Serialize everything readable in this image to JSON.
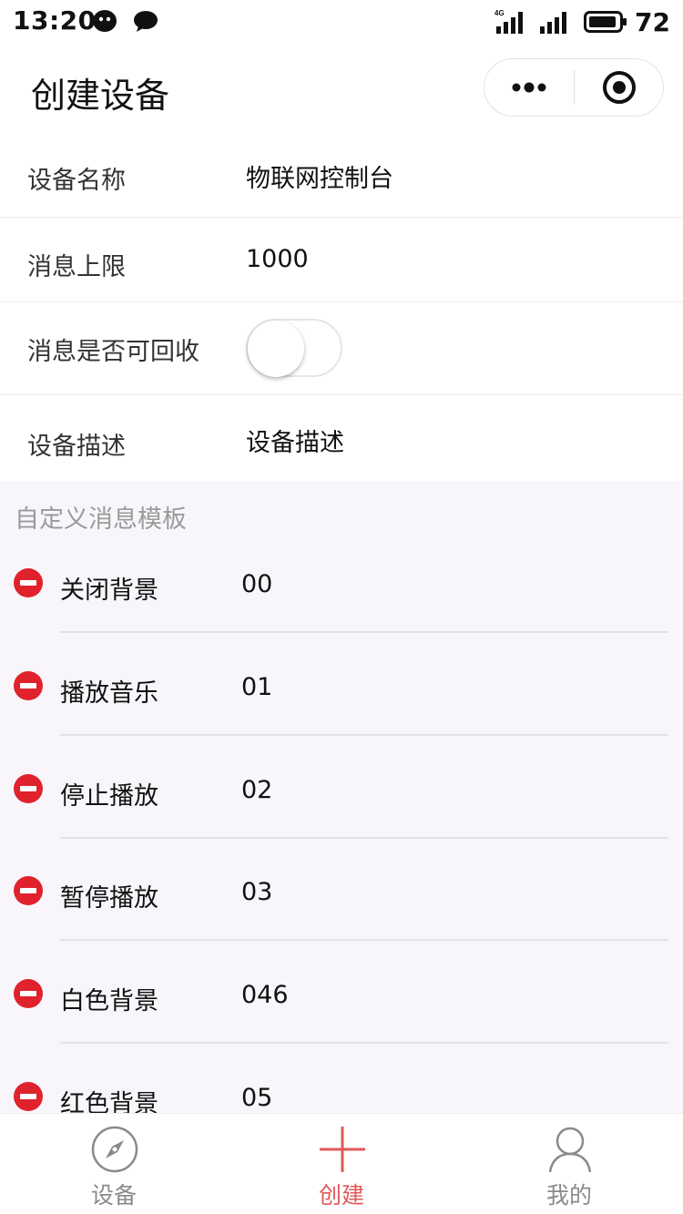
{
  "status_bar": {
    "time": "13:20",
    "network": "4G",
    "battery": "72"
  },
  "nav": {
    "title": "创建设备"
  },
  "form": {
    "device_name_label": "设备名称",
    "device_name_value": "物联网控制台",
    "msg_limit_label": "消息上限",
    "msg_limit_value": "1000",
    "recyclable_label": "消息是否可回收",
    "recyclable_on": false,
    "desc_label": "设备描述",
    "desc_value": "设备描述"
  },
  "templates": {
    "title": "自定义消息模板",
    "items": [
      {
        "name": "关闭背景",
        "code": "00"
      },
      {
        "name": "播放音乐",
        "code": "01"
      },
      {
        "name": "停止播放",
        "code": "02"
      },
      {
        "name": "暂停播放",
        "code": "03"
      },
      {
        "name": "白色背景",
        "code": "046"
      },
      {
        "name": "红色背景",
        "code": "05"
      }
    ]
  },
  "tabbar": {
    "items": [
      {
        "label": "设备",
        "icon": "compass-icon",
        "active": false
      },
      {
        "label": "创建",
        "icon": "plus-icon",
        "active": true
      },
      {
        "label": "我的",
        "icon": "user-icon",
        "active": false
      }
    ]
  },
  "colors": {
    "accent": "#e05a5a",
    "remove": "#e0222c",
    "section_bg": "#f9f6fb"
  }
}
